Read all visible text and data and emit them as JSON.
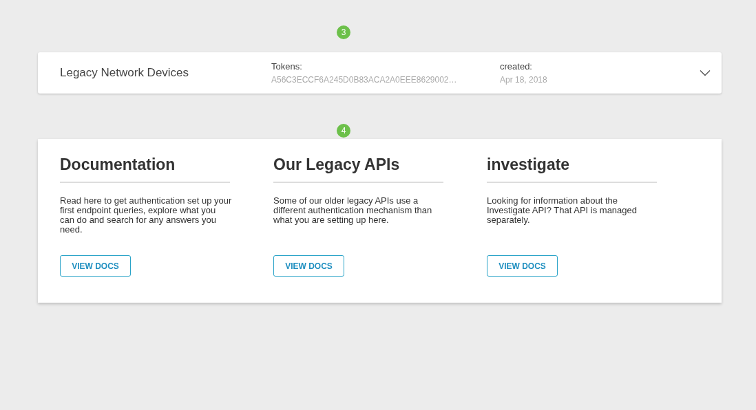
{
  "steps": [
    {
      "number": "3"
    },
    {
      "number": "4"
    }
  ],
  "key_card": {
    "name": "Legacy Network Devices",
    "tokens_label": "Tokens:",
    "token": "A56C3ECCF6A245D0B83ACA2A0EEE8629002…",
    "created_label": "created:",
    "created": "Apr 18, 2018",
    "expanded": false
  },
  "docs": [
    {
      "title": "Documentation",
      "text": "Read here to get authentication set up your first endpoint queries, explore what you can do and search for any answers you need.",
      "button": "VIEW DOCS"
    },
    {
      "title": "Our Legacy APIs",
      "text": "Some of our older legacy APIs use a different authentication mechanism than what you are setting up here.",
      "button": "VIEW DOCS"
    },
    {
      "title": "investigate",
      "text": "Looking for information about the Investigate API? That API is managed separately.",
      "button": "VIEW DOCS"
    }
  ]
}
